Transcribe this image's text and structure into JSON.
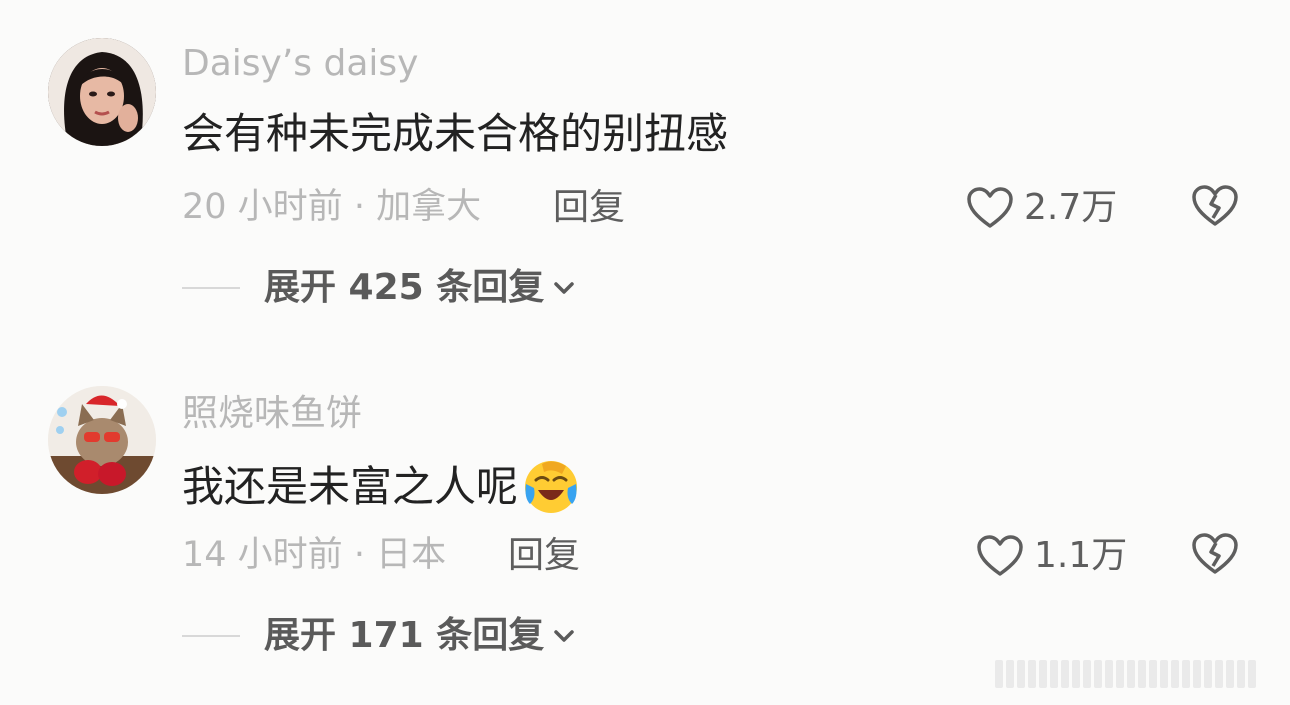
{
  "comments": [
    {
      "username": "Daisy’s daisy",
      "content": "会有种未完成未合格的别扭感",
      "time": "20 小时前",
      "location": "加拿大",
      "separator": "·",
      "reply_label": "回复",
      "likes": "2.7万",
      "expand_label": "展开 425 条回复"
    },
    {
      "username": "照烧味鱼饼",
      "content": "我还是未富之人呢",
      "emoji": "face-with-tears-of-joy",
      "time": "14 小时前",
      "location": "日本",
      "separator": "·",
      "reply_label": "回复",
      "likes": "1.1万",
      "expand_label": "展开 171 条回复"
    }
  ],
  "colors": {
    "background": "#fbfbfa",
    "username": "#b7b7b7",
    "content": "#222222",
    "action": "#5e5e5e",
    "emoji_face": "#ffcc33",
    "emoji_tears": "#38a3f0"
  }
}
